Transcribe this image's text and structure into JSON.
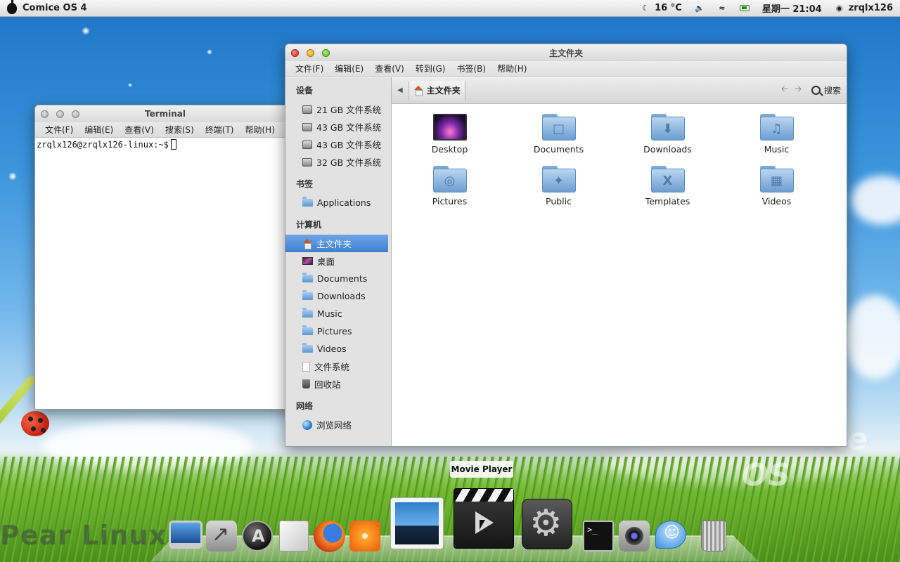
{
  "top_panel": {
    "os_name": "Comice OS 4",
    "weather": "16 °C",
    "clock": "星期一 21:04",
    "user": "zrqlx126"
  },
  "wallpaper": {
    "brand_text": "Pear Linux",
    "os_watermark": "Comice OS"
  },
  "terminal": {
    "title": "Terminal",
    "menu": [
      "文件(F)",
      "编辑(E)",
      "查看(V)",
      "搜索(S)",
      "终端(T)",
      "帮助(H)"
    ],
    "prompt": "zrqlx126@zrqlx126-linux:~$"
  },
  "file_manager": {
    "title": "主文件夹",
    "menu": [
      "文件(F)",
      "编辑(E)",
      "查看(V)",
      "转到(G)",
      "书签(B)",
      "帮助(H)"
    ],
    "path_crumb": "主文件夹",
    "search_label": "搜索",
    "sidebar": {
      "devices_header": "设备",
      "devices": [
        "21 GB 文件系统",
        "43 GB 文件系统",
        "43 GB 文件系统",
        "32 GB 文件系统"
      ],
      "bookmarks_header": "书签",
      "bookmarks": [
        "Applications"
      ],
      "computer_header": "计算机",
      "computer": [
        "主文件夹",
        "桌面",
        "Documents",
        "Downloads",
        "Music",
        "Pictures",
        "Videos",
        "文件系统",
        "回收站"
      ],
      "network_header": "网络",
      "network": [
        "浏览网络"
      ]
    },
    "items": [
      {
        "name": "Desktop",
        "glyph": ""
      },
      {
        "name": "Documents",
        "glyph": "□"
      },
      {
        "name": "Downloads",
        "glyph": "⬇"
      },
      {
        "name": "Music",
        "glyph": "♫"
      },
      {
        "name": "Pictures",
        "glyph": "◎"
      },
      {
        "name": "Public",
        "glyph": "✦"
      },
      {
        "name": "Templates",
        "glyph": "X"
      },
      {
        "name": "Videos",
        "glyph": "▦"
      }
    ]
  },
  "dock": {
    "tooltip": "Movie Player",
    "terminal_glyph": ">_"
  }
}
